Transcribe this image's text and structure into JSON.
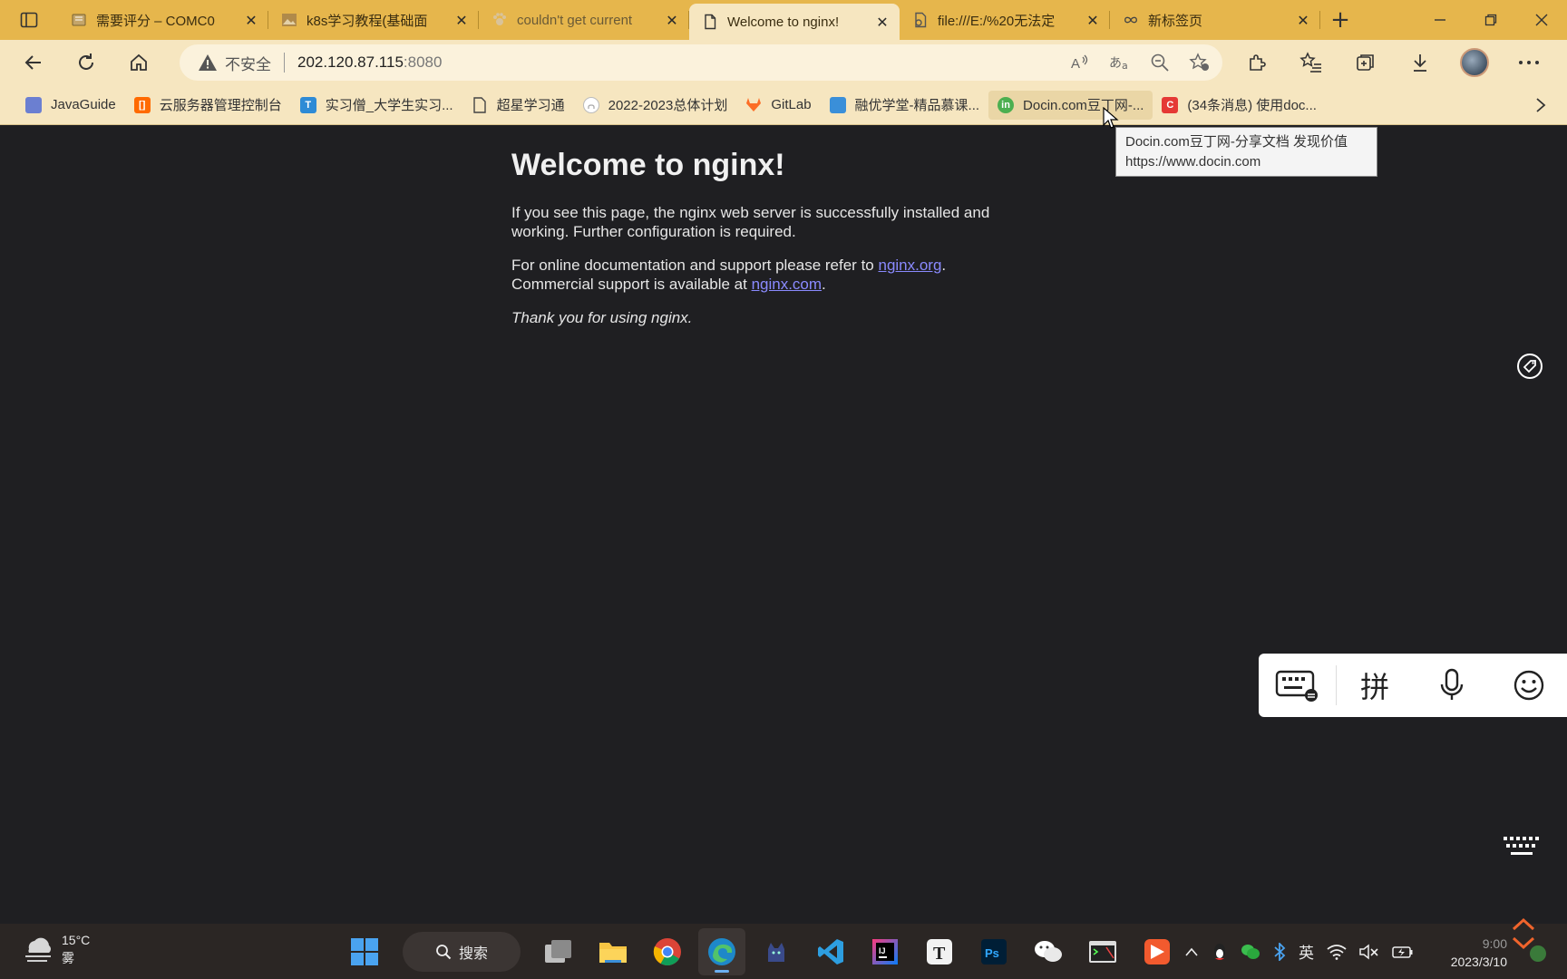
{
  "browser": {
    "tabs": [
      {
        "title": "需要评分 – COMC0",
        "favicon": "notebook-icon"
      },
      {
        "title": "k8s学习教程(基础面",
        "favicon": "image-icon"
      },
      {
        "title": "couldn't get current",
        "favicon": "paw-icon"
      },
      {
        "title": "Welcome to nginx!",
        "favicon": "page-icon",
        "active": true
      },
      {
        "title": "file:///E:/%20无法定",
        "favicon": "file-icon"
      },
      {
        "title": "新标签页",
        "favicon": "infinity-icon"
      }
    ],
    "new_tab_symbol": "+",
    "address": {
      "warning_label": "不安全",
      "host": "202.120.87.115",
      "port": ":8080"
    },
    "bookmarks": [
      {
        "label": "JavaGuide",
        "icon_color": "#6b7fd1"
      },
      {
        "label": "云服务器管理控制台",
        "icon_color": "#ff6a00"
      },
      {
        "label": "实习僧_大学生实习...",
        "icon_color": "#2e8bd6"
      },
      {
        "label": "超星学习通",
        "icon_color": "#888888"
      },
      {
        "label": "2022-2023总体计划",
        "icon_color": "#333333"
      },
      {
        "label": "GitLab",
        "icon_color": "#fc6d26"
      },
      {
        "label": "融优学堂-精品慕课...",
        "icon_color": "#3a8fd9"
      },
      {
        "label": "Docin.com豆丁网-...",
        "icon_color": "#4caf50",
        "hover": true
      },
      {
        "label": "(34条消息) 使用doc...",
        "icon_color": "#e53935"
      }
    ],
    "tooltip": {
      "title": "Docin.com豆丁网-分享文档 发现价值",
      "url": "https://www.docin.com"
    }
  },
  "page": {
    "heading": "Welcome to nginx!",
    "para1": "If you see this page, the nginx web server is successfully installed and working. Further configuration is required.",
    "para2_prefix": "For online documentation and support please refer to ",
    "link_org": "nginx.org",
    "para2_mid": ". Commercial support is available at ",
    "link_com": "nginx.com",
    "para2_suffix": ".",
    "thanks": "Thank you for using nginx."
  },
  "ime": {
    "pinyin_label": "拼"
  },
  "taskbar": {
    "weather_temp": "15°C",
    "weather_desc": "雾",
    "search_label": "搜索",
    "ime_lang": "英",
    "clock_time": "9:00",
    "clock_date": "2023/3/10"
  }
}
